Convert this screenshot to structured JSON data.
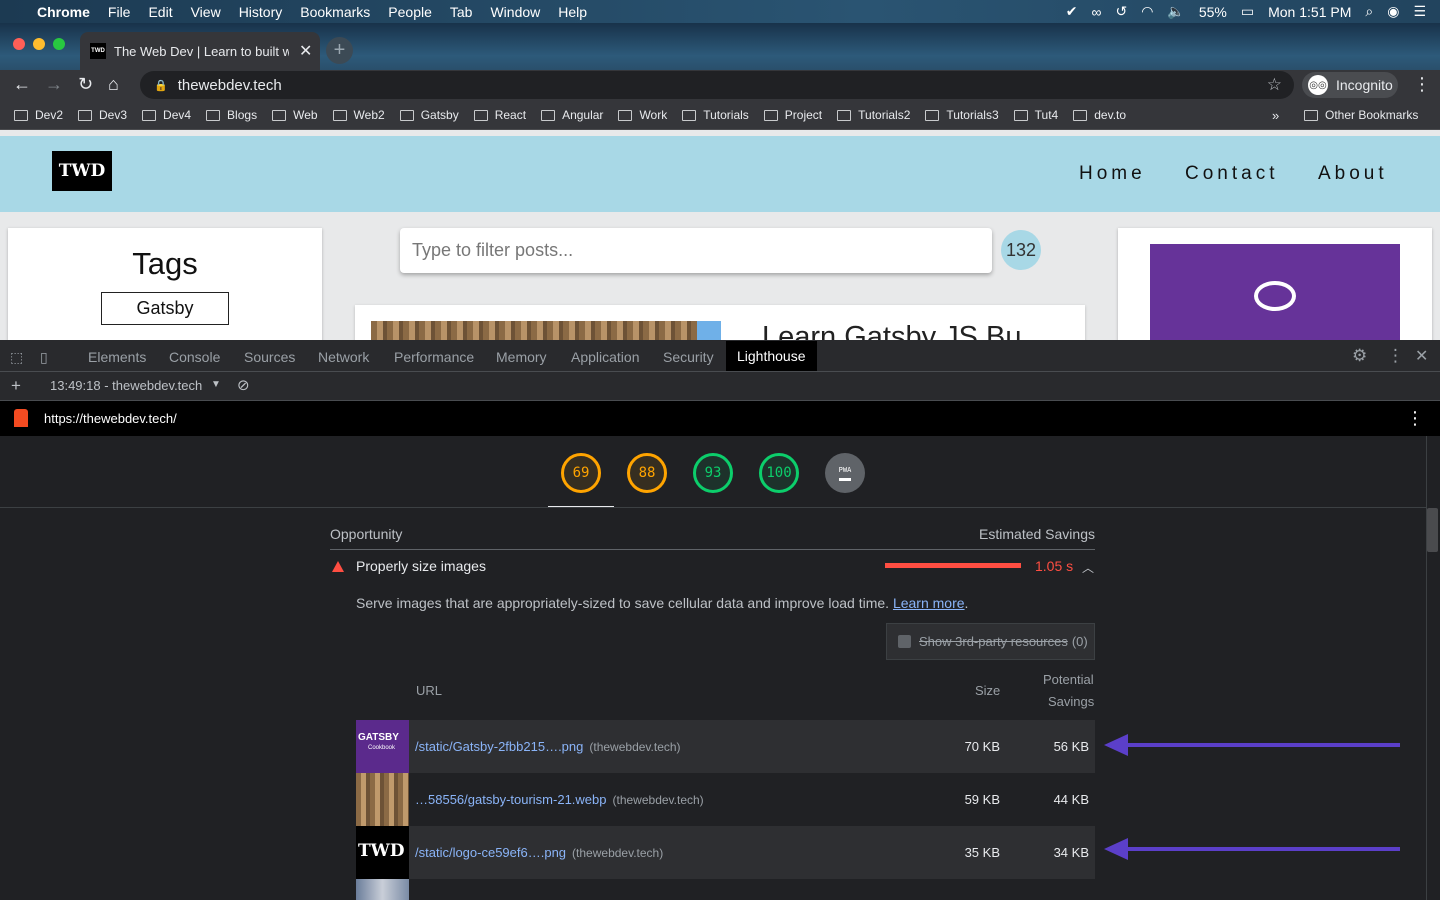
{
  "menubar": {
    "app": "Chrome",
    "items": [
      "File",
      "Edit",
      "View",
      "History",
      "Bookmarks",
      "People",
      "Tab",
      "Window",
      "Help"
    ],
    "battery": "55%",
    "clock": "Mon 1:51 PM"
  },
  "tab": {
    "title": "The Web Dev | Learn to built w",
    "favicon": "TWD",
    "close": "✕",
    "new": "+"
  },
  "toolbar": {
    "url": "thewebdev.tech",
    "incognito": "Incognito"
  },
  "bookmarks": {
    "items": [
      "Dev2",
      "Dev3",
      "Dev4",
      "Blogs",
      "Web",
      "Web2",
      "Gatsby",
      "React",
      "Angular",
      "Work",
      "Tutorials",
      "Project",
      "Tutorials2",
      "Tutorials3",
      "Tut4",
      "dev.to"
    ],
    "more": "»",
    "other": "Other Bookmarks"
  },
  "site": {
    "logo": "TWD",
    "nav": [
      "Home",
      "Contact",
      "About"
    ],
    "tags_title": "Tags",
    "tag": "Gatsby",
    "filter_placeholder": "Type to filter posts...",
    "count": "132",
    "post_title": "Learn Gatsby JS Bu"
  },
  "devtools": {
    "tabs": [
      "Elements",
      "Console",
      "Sources",
      "Network",
      "Performance",
      "Memory",
      "Application",
      "Security",
      "Lighthouse"
    ],
    "active_tab": "Lighthouse",
    "report": "13:49:18 - thewebdev.tech",
    "lh_url": "https://thewebdev.tech/"
  },
  "scores": [
    {
      "value": "69",
      "status": "orange"
    },
    {
      "value": "88",
      "status": "orange"
    },
    {
      "value": "93",
      "status": "green"
    },
    {
      "value": "100",
      "status": "green"
    }
  ],
  "pwa": {
    "label": "PWA"
  },
  "opportunity": {
    "header_left": "Opportunity",
    "header_right": "Estimated Savings",
    "title": "Properly size images",
    "savings": "1.05 s",
    "description": "Serve images that are appropriately-sized to save cellular data and improve load time.",
    "learn_more": "Learn more",
    "period": ".",
    "third_party": "Show 3rd-party resources",
    "third_party_count": "(0)",
    "col_url": "URL",
    "col_size": "Size",
    "col_potential_1": "Potential",
    "col_potential_2": "Savings",
    "rows": [
      {
        "url": "/static/Gatsby-2fbb215….png",
        "host": "(thewebdev.tech)",
        "size": "70 KB",
        "savings": "56 KB",
        "thumb_text": "GATSBY",
        "thumb_sub": "Cookbook"
      },
      {
        "url": "…58556/gatsby-tourism-21.webp",
        "host": "(thewebdev.tech)",
        "size": "59 KB",
        "savings": "44 KB"
      },
      {
        "url": "/static/logo-ce59ef6….png",
        "host": "(thewebdev.tech)",
        "size": "35 KB",
        "savings": "34 KB",
        "thumb_text": "TWD"
      }
    ]
  },
  "colors": {
    "accent_purple": "#5b3fc9",
    "fail_red": "#ff4e42",
    "avg_orange": "#ffa400",
    "pass_green": "#0cce6b",
    "site_header": "#a8d8e6"
  }
}
